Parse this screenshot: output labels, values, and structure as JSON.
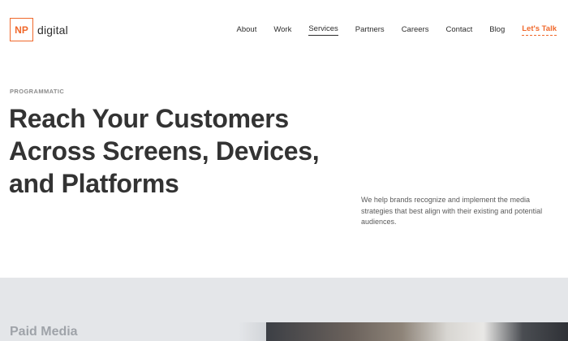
{
  "logo": {
    "mark": "NP",
    "name": "digital"
  },
  "nav": {
    "items": [
      {
        "label": "About"
      },
      {
        "label": "Work"
      },
      {
        "label": "Services"
      },
      {
        "label": "Partners"
      },
      {
        "label": "Careers"
      },
      {
        "label": "Contact"
      },
      {
        "label": "Blog"
      }
    ],
    "active": "Services",
    "cta_label": "Let's Talk"
  },
  "hero": {
    "eyebrow": "PROGRAMMATIC",
    "headline": "Reach Your Customers Across Screens, Devices, and Platforms",
    "lead": "We help brands recognize and implement the media strategies that best align with their existing and potential audiences."
  },
  "section": {
    "title": "Paid Media"
  },
  "colors": {
    "accent": "#f0682b",
    "text": "#2d2d2d",
    "band": "#e4e6e9"
  }
}
